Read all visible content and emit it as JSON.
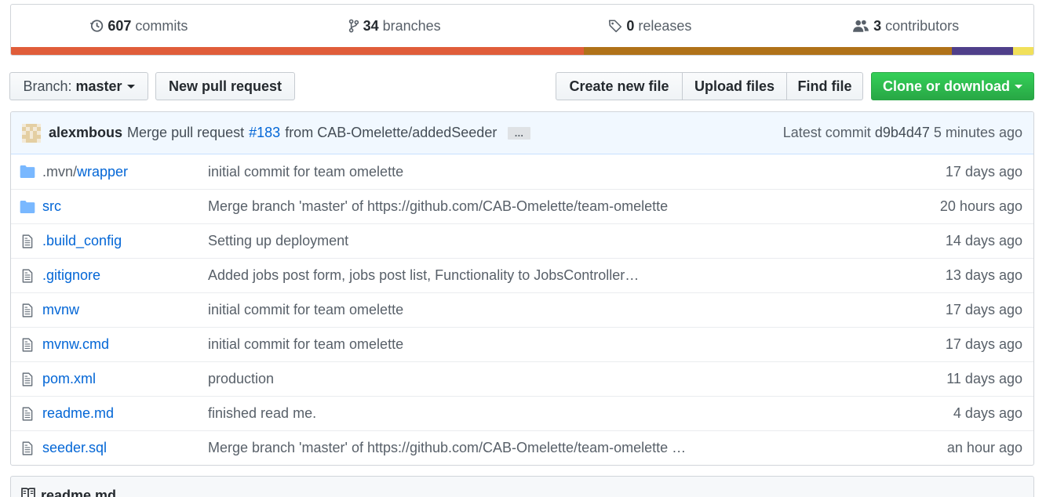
{
  "summary": {
    "commits": {
      "count": "607",
      "label": "commits",
      "icon": "history-icon"
    },
    "branches": {
      "count": "34",
      "label": "branches",
      "icon": "git-branch-icon"
    },
    "releases": {
      "count": "0",
      "label": "releases",
      "icon": "tag-icon"
    },
    "contributors": {
      "count": "3",
      "label": "contributors",
      "icon": "people-icon"
    },
    "languages": [
      {
        "color": "#e05d3a",
        "share": 0.56
      },
      {
        "color": "#b07219",
        "share": 0.36
      },
      {
        "color": "#4f3f8a",
        "share": 0.06
      },
      {
        "color": "#f1e05a",
        "share": 0.02
      }
    ]
  },
  "toolbar": {
    "branch_prefix": "Branch:",
    "branch_name": "master",
    "new_pull_request": "New pull request",
    "create_new_file": "Create new file",
    "upload_files": "Upload files",
    "find_file": "Find file",
    "clone_or_download": "Clone or download"
  },
  "commit": {
    "author": "alexmbous",
    "message_prefix": "Merge pull request",
    "pr_link": "#183",
    "message_suffix": "from CAB-Omelette/addedSeeder",
    "ellipsis": "…",
    "latest_label": "Latest commit",
    "sha": "d9b4d47",
    "age": "5 minutes ago"
  },
  "files": [
    {
      "type": "folder",
      "name_dim": ".mvn/",
      "name": "wrapper",
      "message": "initial commit for team omelette",
      "age": "17 days ago"
    },
    {
      "type": "folder",
      "name_dim": "",
      "name": "src",
      "message": "Merge branch 'master' of https://github.com/CAB-Omelette/team-omelette",
      "age": "20 hours ago"
    },
    {
      "type": "file",
      "name_dim": "",
      "name": ".build_config",
      "message": "Setting up deployment",
      "age": "14 days ago"
    },
    {
      "type": "file",
      "name_dim": "",
      "name": ".gitignore",
      "message": "Added jobs post form, jobs post list, Functionality to JobsController…",
      "age": "13 days ago"
    },
    {
      "type": "file",
      "name_dim": "",
      "name": "mvnw",
      "message": "initial commit for team omelette",
      "age": "17 days ago"
    },
    {
      "type": "file",
      "name_dim": "",
      "name": "mvnw.cmd",
      "message": "initial commit for team omelette",
      "age": "17 days ago"
    },
    {
      "type": "file",
      "name_dim": "",
      "name": "pom.xml",
      "message": "production",
      "age": "11 days ago"
    },
    {
      "type": "file",
      "name_dim": "",
      "name": "readme.md",
      "message": "finished read me.",
      "age": "4 days ago"
    },
    {
      "type": "file",
      "name_dim": "",
      "name": "seeder.sql",
      "message": "Merge branch 'master' of https://github.com/CAB-Omelette/team-omelette …",
      "age": "an hour ago"
    }
  ],
  "readme": {
    "title": "readme.md",
    "icon": "book-icon"
  }
}
